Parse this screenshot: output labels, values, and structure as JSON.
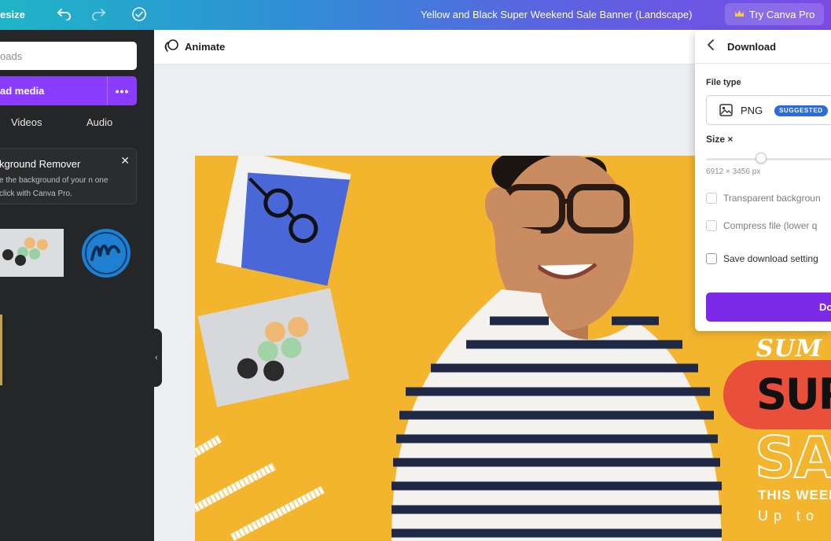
{
  "topbar": {
    "resize_label": "esize",
    "undo_icon": "undo-icon",
    "redo_icon": "redo-icon",
    "cloud_icon": "cloud-saved-icon",
    "design_title": "Yellow and Black Super Weekend Sale Banner (Landscape)",
    "pro_label": "Try Canva Pro",
    "pro_icon": "crown-icon"
  },
  "left_panel": {
    "search_placeholder": "oads",
    "upload_button": "ad media",
    "more_label": "•••",
    "tabs": [
      "Videos",
      "Audio"
    ],
    "promo": {
      "title": "kground Remover",
      "description": "e the background of your n one click with Canva Pro.",
      "close": "✕"
    }
  },
  "editor": {
    "animate_label": "Animate"
  },
  "canvas": {
    "script_text": "SUM",
    "super_text": "SUP",
    "sale_text": "SA",
    "weekend_text": "THIS WEEK",
    "upto_text": "Up to"
  },
  "download_panel": {
    "title": "Download",
    "file_type_label": "File type",
    "file_type_value": "PNG",
    "suggested_badge": "SUGGESTED",
    "size_label": "Size ×",
    "size_dims": "6912 × 3456 px",
    "options": [
      {
        "label": "Transparent backgroun",
        "enabled": false
      },
      {
        "label": "Compress file (lower q",
        "enabled": false
      },
      {
        "label": "Save download setting",
        "enabled": true
      }
    ],
    "download_button": "Do"
  },
  "colors": {
    "accent_purple": "#8b3dff",
    "canvas_yellow": "#f3b52e",
    "badge_blue": "#2b6bdc",
    "sale_red": "#e9503b"
  }
}
